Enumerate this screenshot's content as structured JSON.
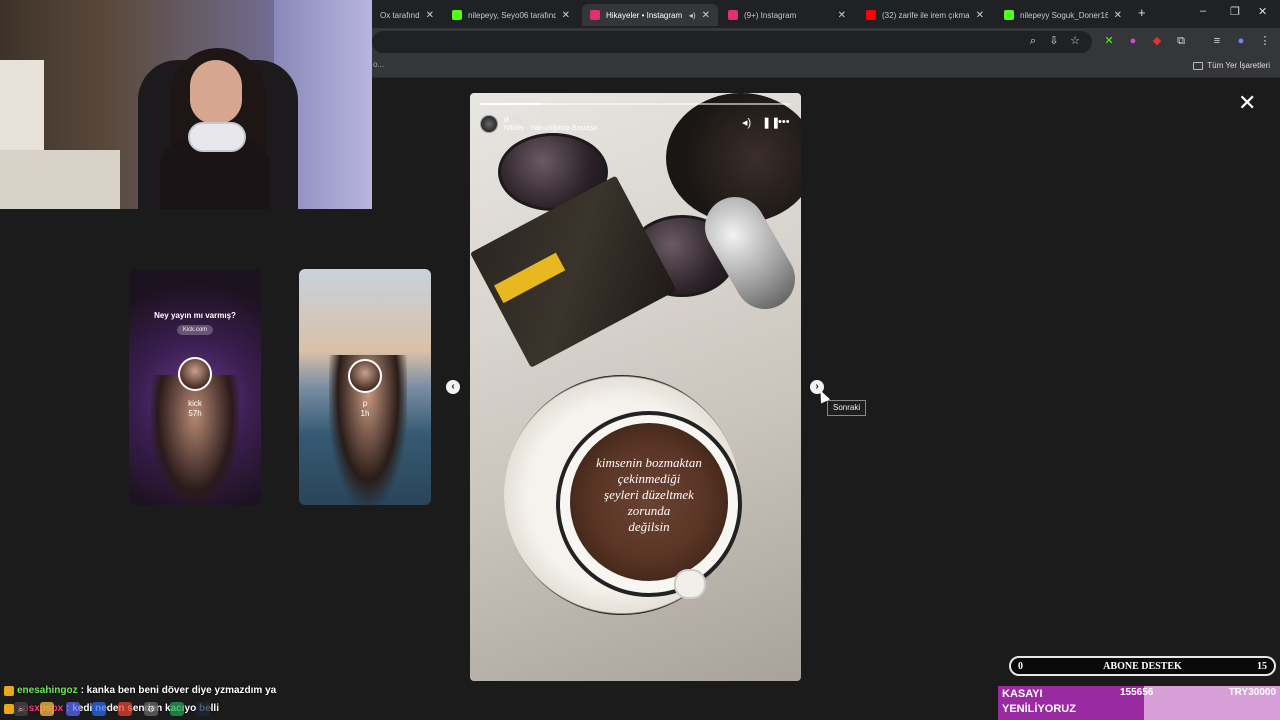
{
  "browser": {
    "tabs": [
      {
        "title": "Ox tarafınd",
        "favicon_color": "#f0b400",
        "active": false
      },
      {
        "title": "nilepeyy, Seyo06 tarafında",
        "favicon_color": "#53fc18",
        "active": false
      },
      {
        "title": "Hikayeler • Instagram",
        "favicon_color": "#e1306c",
        "active": true
      },
      {
        "title": "(9+) Instagram",
        "favicon_color": "#e1306c",
        "active": false
      },
      {
        "title": "(32) zarife ile irem çıkmal",
        "favicon_color": "#ff0000",
        "active": false
      },
      {
        "title": "nilepeyy Soguk_Doner16",
        "favicon_color": "#53fc18",
        "active": false
      }
    ],
    "close_glyph": "✕",
    "new_tab_glyph": "+",
    "bookmarks_right": "Tüm Yer İşaretleri",
    "bookmarks_left_truncated": "o..."
  },
  "stories": {
    "close_glyph": "✕",
    "prev_glyph": "‹",
    "next_glyph": "›",
    "next_tooltip": "Sonraki",
    "thumbnails": [
      {
        "headline": "Ney yayın mı varmış?",
        "pill": "Kick.com",
        "user": "kick",
        "time": "57h"
      },
      {
        "user": "p",
        "time": "1h"
      }
    ],
    "main": {
      "user": "d",
      "time": "6h",
      "music": "Nilüfer · Yalnızlığımla Baştaşa",
      "progress": 0.2,
      "quote_lines": [
        "kimsenin bozmaktan",
        "çekinmediği",
        "şeyleri düzeltmek",
        "zorunda",
        "değilsin"
      ]
    }
  },
  "chat": [
    {
      "user": "enesahingoz",
      "message": ": kanka ben beni döver diye yzmazdım ya"
    },
    {
      "user": "xpsxpspx",
      "message": ": kedi neden senden kacıyo belli"
    }
  ],
  "overlays": {
    "abone": {
      "left": "0",
      "label": "ABONE DESTEK",
      "right": "15"
    },
    "kasa": {
      "label_line1": "KASAYI",
      "label_line2": "YENİLİYORUZ",
      "current": "155656",
      "goal": "TRY30000"
    }
  }
}
